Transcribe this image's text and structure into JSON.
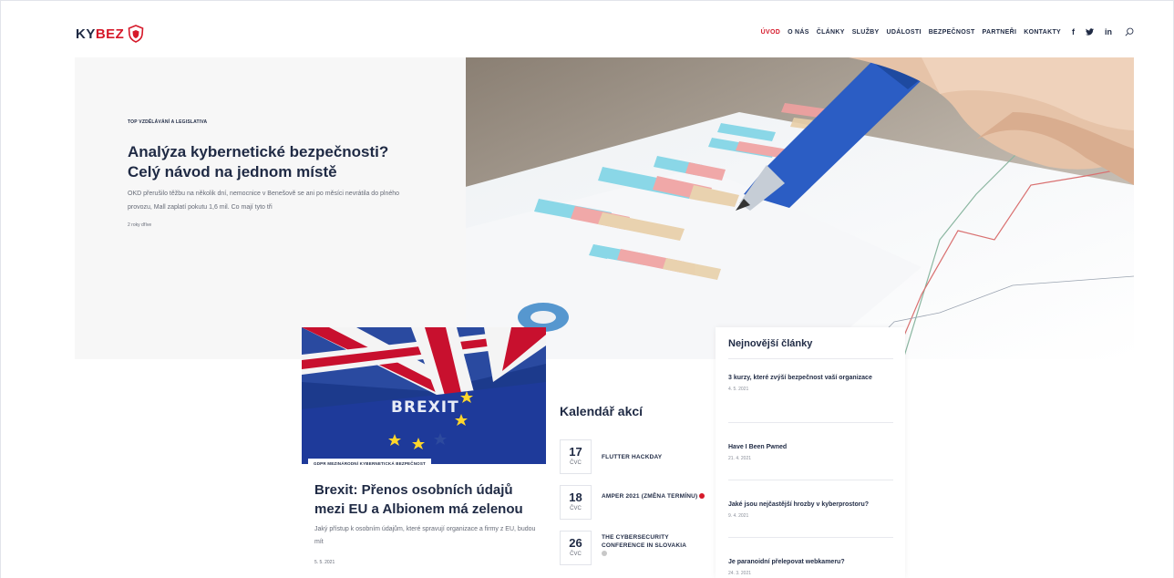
{
  "header": {
    "logo_ky": "KY",
    "logo_bez": "BEZ",
    "nav": [
      "ÚVOD",
      "O NÁS",
      "ČLÁNKY",
      "SLUŽBY",
      "UDÁLOSTI",
      "BEZPEČNOST",
      "PARTNEŘI",
      "KONTAKTY"
    ],
    "social": [
      "f",
      "t",
      "in"
    ],
    "colors": {
      "accent": "#d6192a",
      "text": "#1f2a44"
    }
  },
  "hero": {
    "category": "TOP VZDĚLÁVÁNÍ A LEGISLATIVA",
    "title": "Analýza kybernetické bezpečnosti? Celý návod na jednom místě",
    "excerpt": "OKD přerušilo těžbu na několik dní, nemocnice v Benešově se ani po měsíci nevrátila do plného provozu, Mall zaplatí pokutu 1,6 mil. Co mají tyto tři",
    "time": "2 roky dříve"
  },
  "card": {
    "image_text": "BREXIT",
    "category": "GDPR MEZINÁRODNÍ KYBERNETICKÁ BEZPEČNOST",
    "title": "Brexit: Přenos osobních údajů mezi EU a Albionem má zelenou",
    "excerpt": "Jaký přístup k osobním údajům, které spravují organizace a firmy z EU, budou mít",
    "date": "5. 5. 2021"
  },
  "calendar": {
    "title": "Kalendář akcí",
    "events": [
      {
        "day": "17",
        "month": "ČVC",
        "name": "FLUTTER HACKDAY"
      },
      {
        "day": "18",
        "month": "ČVC",
        "name": "AMPER 2021 (ZMĚNA TERMÍNU)",
        "dot": "#d6192a"
      },
      {
        "day": "26",
        "month": "ČVC",
        "name": "THE CYBERSECURITY CONFERENCE IN SLOVAKIA",
        "dot": "#c8c8c8"
      }
    ]
  },
  "latest": {
    "title": "Nejnovější články",
    "items": [
      {
        "title": "3 kurzy, které zvýší bezpečnost vaší organizace",
        "date": "4. 5. 2021"
      },
      {
        "title": "Have I Been Pwned",
        "date": "21. 4. 2021"
      },
      {
        "title": "Jaké jsou nejčastější hrozby v kyberprostoru?",
        "date": "9. 4. 2021"
      },
      {
        "title": "Je paranoidní přelepovat webkameru?",
        "date": "24. 3. 2021"
      }
    ]
  }
}
